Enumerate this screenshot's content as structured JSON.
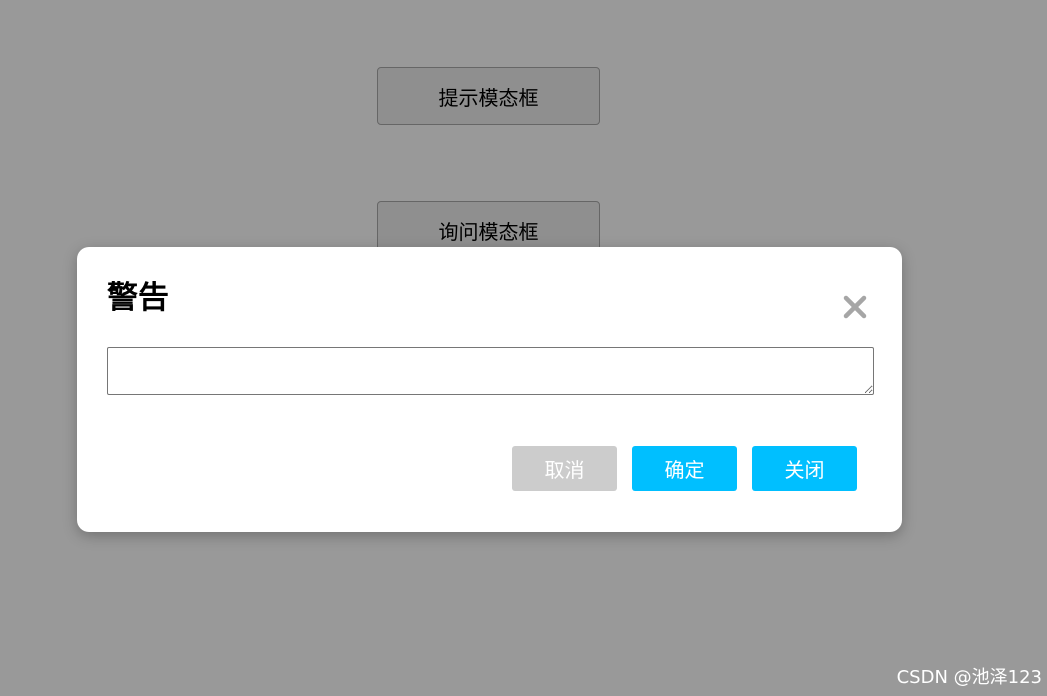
{
  "page": {
    "buttons": {
      "prompt_modal": "提示模态框",
      "confirm_modal": "询问模态框"
    }
  },
  "modal": {
    "title": "警告",
    "close_icon": "close-x-icon",
    "textarea": {
      "value": "",
      "placeholder": ""
    },
    "footer": {
      "cancel_label": "取消",
      "ok_label": "确定",
      "close_label": "关闭"
    }
  },
  "watermark": "CSDN @池泽123",
  "colors": {
    "overlay": "#999999",
    "primary_button": "#00bfff",
    "disabled_button": "#cccccc",
    "close_icon": "#a6a6a6"
  }
}
